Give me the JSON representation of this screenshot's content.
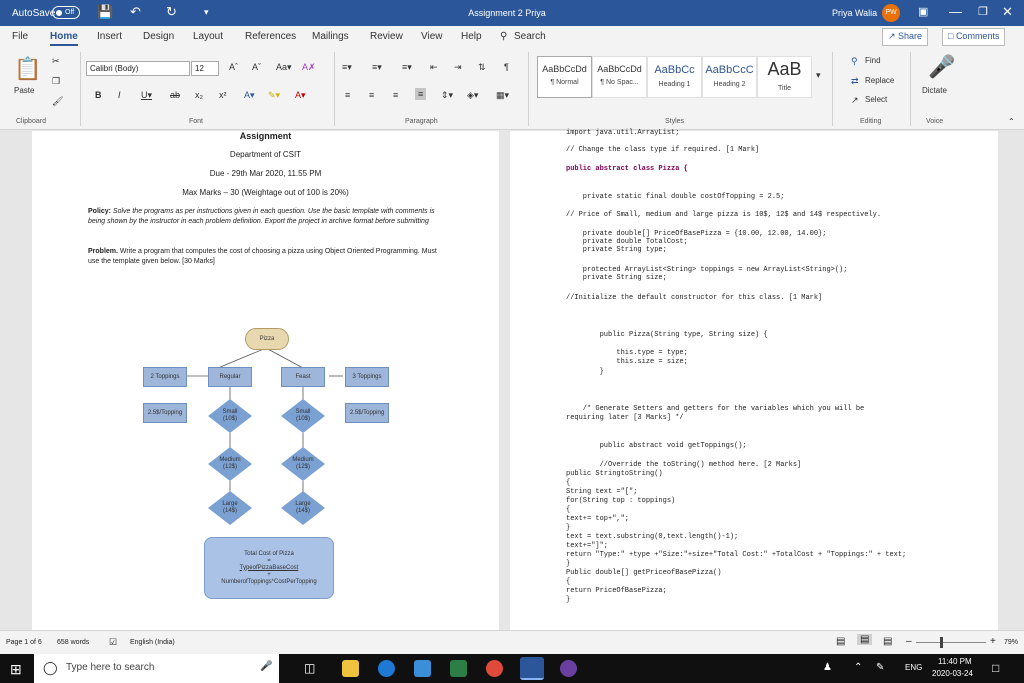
{
  "titlebar": {
    "autosave_label": "AutoSave",
    "autosave_state": "Off",
    "doc_title": "Assignment 2 Priya",
    "user_name": "Priya Walia",
    "user_initials": "PW"
  },
  "menu": {
    "items": [
      "File",
      "Home",
      "Insert",
      "Design",
      "Layout",
      "References",
      "Mailings",
      "Review",
      "View",
      "Help"
    ],
    "search": "Search",
    "share": "Share",
    "comments": "Comments"
  },
  "ribbon": {
    "paste": "Paste",
    "font_name": "Calibri (Body)",
    "font_size": "12",
    "styles": [
      {
        "preview": "AaBbCcDd",
        "name": "¶ Normal"
      },
      {
        "preview": "AaBbCcDd",
        "name": "¶ No Spac..."
      },
      {
        "preview": "AaBbCc",
        "name": "Heading 1"
      },
      {
        "preview": "AaBbCcC",
        "name": "Heading 2"
      },
      {
        "preview": "AaB",
        "name": "Title"
      }
    ],
    "find": "Find",
    "replace": "Replace",
    "select": "Select",
    "dictate": "Dictate",
    "groups": {
      "clipboard": "Clipboard",
      "font": "Font",
      "paragraph": "Paragraph",
      "styles": "Styles",
      "editing": "Editing",
      "voice": "Voice"
    }
  },
  "page1": {
    "heading": "Assignment",
    "dept": "Department of CSIT",
    "due": "Due - 29th Mar 2020, 11.55 PM",
    "maxmarks": "Max Marks – 30 (Weightage out of 100 is 20%)",
    "policy_label": "Policy:",
    "policy": "Solve the programs as per instructions given in each question. Use the basic template with comments is being shown by the instructor in each problem definition. Export the project in archive format before submitting",
    "problem_label": "Problem.",
    "problem": "Write a program that computes the cost of choosing a pizza using Object Oriented Programming. Must use the template given below. [30 Marks]"
  },
  "diagram": {
    "pizza": "Pizza",
    "two_toppings": "2 Toppings",
    "regular": "Regular",
    "feast": "Feast",
    "three_toppings": "3 Toppings",
    "topping_cost_left": "2.5$/Topping",
    "small_left": "Small\n(10$)",
    "small_right": "Small\n(10$)",
    "topping_cost_right": "2.5$/Topping",
    "medium_left": "Medium\n(12$)",
    "medium_right": "Medium\n(12$)",
    "large_left": "Large\n(14$)",
    "large_right": "Large\n(14$)",
    "total_title": "Total Cost of Pizza",
    "total_eq": "=",
    "total_line1": "TypeofPizzaBaseCost",
    "total_plus": "+",
    "total_line2": "NumberofToppings*CostPerTopping"
  },
  "code": [
    "import java.util.ArrayList;",
    "// Change the class type if required. [1 Mark]",
    "public abstract class Pizza {",
    "    private static final double costOfTopping = 2.5;",
    "// Price of Small, medium and large pizza is 10$, 12$ and 14$ respectively.",
    "    private double[] PriceOfBasePizza = {10.00, 12.00, 14.00};",
    "    private double TotalCost;",
    "    private String type;",
    "    protected ArrayList<String> toppings = new ArrayList<String>();",
    "    private String size;",
    "//Initialize the default constructor for this class. [1 Mark]",
    "        public Pizza(String type, String size) {",
    "            this.type = type;",
    "            this.size = size;",
    "        }",
    "    /* Generate Setters and getters for the variables which you will be",
    "requiring later [3 Marks] */",
    "        public abstract void getToppings();",
    "        //Override the toString() method here. [2 Marks]",
    "public StringtoString()",
    "{",
    "String text =\"[\";",
    "for(String top : toppings)",
    "{",
    "text+= top+\",\";",
    "}",
    "text = text.substring(0,text.length()-1);",
    "text+=\"]\";",
    "return \"Type:\" +type +\"Size:\"+size+\"Total Cost:\" +TotalCost + \"Toppings:\" + text;",
    "}",
    "Public double[] getPriceofBasePizza()",
    "{",
    "return PriceOfBasePizza;",
    "}"
  ],
  "status": {
    "page": "Page 1 of 6",
    "words": "658 words",
    "language": "English (India)",
    "zoom": "79%"
  },
  "taskbar": {
    "search": "Type here to search",
    "language": "ENG",
    "time": "11:40 PM",
    "date": "2020-03-24"
  },
  "colors": {
    "word_blue": "#2b579a",
    "diagram_rect": "#9db6d9",
    "diagram_diamond": "#7ba0d2",
    "pizza_node": "#e8d8b0",
    "total_box": "#a9c2e6"
  }
}
